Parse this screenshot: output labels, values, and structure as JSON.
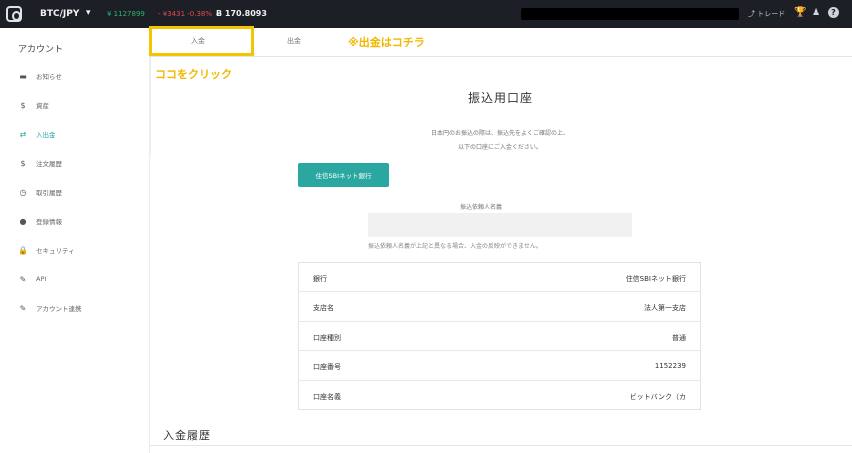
{
  "topbar": {
    "pair": "BTC/JPY",
    "price": "¥ 1127899",
    "change": "- ¥3431 -0.38%",
    "volume": "Ƀ 170.8093",
    "trade_label": "トレード"
  },
  "sidebar": {
    "title": "アカウント",
    "items": [
      {
        "label": "お知らせ",
        "icon": "▬"
      },
      {
        "label": "資産",
        "icon": "$"
      },
      {
        "label": "入出金",
        "icon": "⇄"
      },
      {
        "label": "注文履歴",
        "icon": "$"
      },
      {
        "label": "取引履歴",
        "icon": "◷"
      },
      {
        "label": "登録情報",
        "icon": "●"
      },
      {
        "label": "セキュリティ",
        "icon": "🔒"
      },
      {
        "label": "API",
        "icon": "✎"
      },
      {
        "label": "アカウント連携",
        "icon": "✎"
      }
    ]
  },
  "tabs": {
    "deposit": "入金",
    "withdraw": "出金"
  },
  "notes": {
    "withdraw_note": "※出金はコチラ",
    "click_note": "ココをクリック"
  },
  "main": {
    "title": "振込用口座",
    "desc_line1": "日本円のお振込の際は、振込先をよくご確認の上、",
    "desc_line2": "以下の口座にご入金ください。",
    "bank_button": "住信SBIネット銀行",
    "name_label": "振込依頼人名義",
    "name_warning": "振込依頼人名義が上記と異なる場合、入金の反映ができません。",
    "rows": [
      {
        "key": "銀行",
        "value": "住信SBIネット銀行"
      },
      {
        "key": "支店名",
        "value": "法人第一支店"
      },
      {
        "key": "口座種別",
        "value": "普通"
      },
      {
        "key": "口座番号",
        "value": "1152239"
      },
      {
        "key": "口座名義",
        "value": "ビットバンク（カ"
      }
    ],
    "history_title": "入金履歴"
  },
  "colors": {
    "accent": "#2aa7a0",
    "highlight": "#f5c400",
    "note_text": "#f2b700",
    "topbar_bg": "#1c1f26"
  }
}
